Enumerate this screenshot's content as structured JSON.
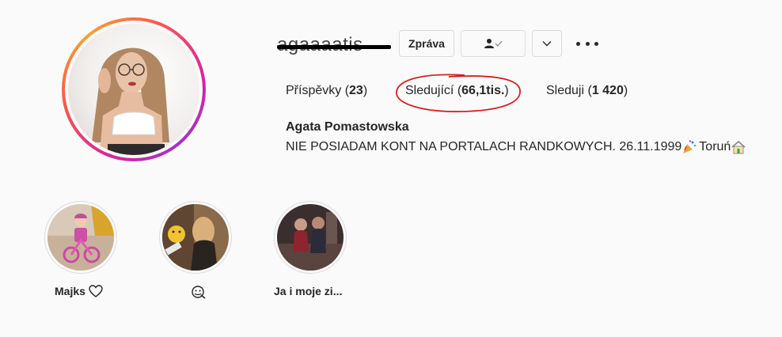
{
  "profile": {
    "username": "agaaaatis",
    "full_name": "Agata Pomastowska",
    "bio": "NIE POSIADAM KONT NA PORTALACH RANDKOWYCH. 26.11.1999",
    "bio_location": "Toruń"
  },
  "actions": {
    "message_label": "Zpráva",
    "follow_icon": "user-check-icon",
    "dropdown_icon": "chevron-down-icon",
    "more_icon": "more-dots-icon"
  },
  "stats": {
    "posts_label": "Příspěvky",
    "posts_count": "23",
    "followers_label": "Sledující",
    "followers_count": "66,1tis.",
    "following_label": "Sleduji",
    "following_count": "1 420"
  },
  "highlights": [
    {
      "label": "Majks",
      "icon": "heart-icon"
    },
    {
      "label": "",
      "icon": "face-icon"
    },
    {
      "label": "Ja i moje zi..."
    }
  ],
  "colors": {
    "annotation": "#d62020",
    "border": "#dbdbdb",
    "text": "#262626"
  }
}
